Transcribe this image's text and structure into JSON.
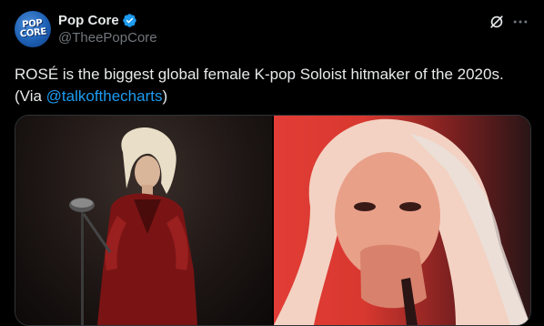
{
  "author": {
    "display_name": "Pop Core",
    "handle": "@TheePopCore",
    "verified": true,
    "avatar": {
      "line1": "POP",
      "line2": "CORE"
    }
  },
  "actions": {
    "grok_icon": "grok-icon",
    "more_icon": "more-icon"
  },
  "tweet": {
    "text_main": "ROSÉ is the biggest global female K-pop Soloist hitmaker of the 2020s. (Via ",
    "mention": "@talkofthecharts",
    "text_end": ")"
  },
  "media": {
    "count": 2
  },
  "colors": {
    "background": "#000000",
    "text": "#e7e9ea",
    "secondary_text": "#71767b",
    "accent": "#1d9bf0",
    "border": "#2f3336"
  }
}
